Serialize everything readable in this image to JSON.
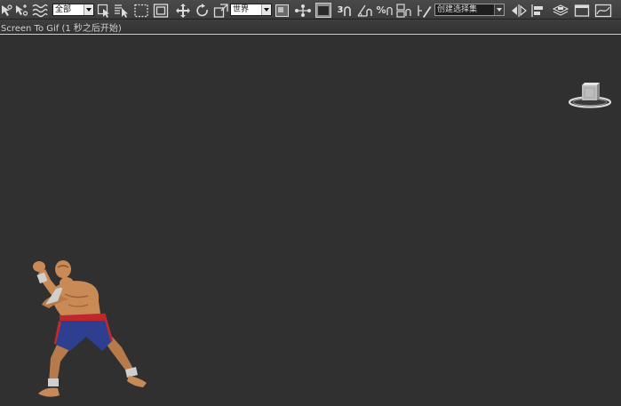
{
  "toolbar": {
    "selection_filter": "全部",
    "reference_coordinate_system": "世界",
    "named_selection_set": "创建选择集",
    "snap_toggle_label": "3",
    "percent_snap_label": "%"
  },
  "window": {
    "title": "Screen To Gif (1 秒之后开始)"
  },
  "icons": {
    "select_link": "select-link-icon",
    "unlink": "unlink-icon",
    "bind_space_warp": "bind-space-warp-icon",
    "select_object": "select-object-icon",
    "select_by_name": "select-by-name-icon",
    "rectangular_selection": "rectangular-selection-icon",
    "window_crossing": "window-crossing-icon",
    "move": "move-icon",
    "rotate": "rotate-icon",
    "scale": "scale-icon",
    "mirror": "mirror-icon",
    "align": "align-icon",
    "viewcube": "viewcube-icon"
  },
  "colors": {
    "viewport_background": "#303030",
    "toolbar_background": "#444444",
    "title_line": "#d6d6d6"
  }
}
